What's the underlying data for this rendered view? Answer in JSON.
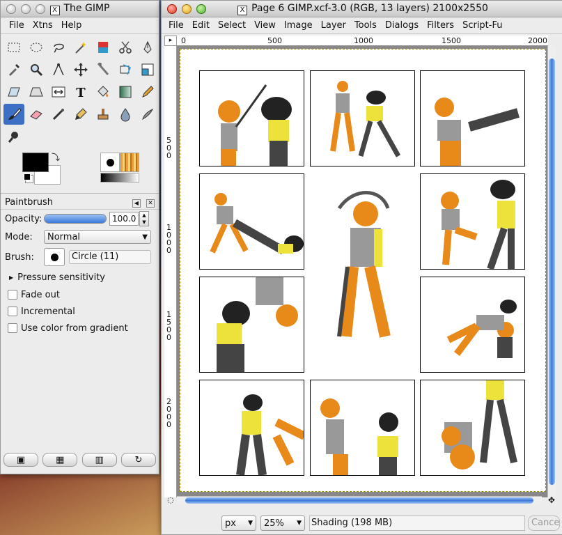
{
  "toolbox": {
    "title": "The GIMP",
    "menu": [
      "File",
      "Xtns",
      "Help"
    ],
    "tools": [
      "rect-select-icon",
      "ellipse-select-icon",
      "lasso-icon",
      "fuzzy-select-icon",
      "color-select-icon",
      "scissors-icon",
      "paths-icon",
      "color-picker-icon",
      "magnify-icon",
      "measure-icon",
      "move-icon",
      "crop-icon",
      "rotate-icon",
      "scale-icon",
      "shear-icon",
      "perspective-icon",
      "flip-icon",
      "text-icon",
      "bucket-fill-icon",
      "blend-icon",
      "pencil-icon",
      "paintbrush-icon",
      "eraser-icon",
      "airbrush-icon",
      "ink-icon",
      "clone-icon",
      "convolve-icon",
      "smudge-icon",
      "dodge-burn-icon"
    ],
    "fg_color": "#000000",
    "bg_color": "#ffffff",
    "options": {
      "title": "Paintbrush",
      "opacity_label": "Opacity:",
      "opacity_value": "100.0",
      "opacity_fraction": 1.0,
      "mode_label": "Mode:",
      "mode_value": "Normal",
      "brush_label": "Brush:",
      "brush_value": "Circle (11)",
      "pressure_label": "Pressure sensitivity",
      "checkboxes": [
        "Fade out",
        "Incremental",
        "Use color from gradient"
      ]
    }
  },
  "image_window": {
    "title": "Page 6 GIMP.xcf-3.0 (RGB, 13 layers) 2100x2550",
    "menu": [
      "File",
      "Edit",
      "Select",
      "View",
      "Image",
      "Layer",
      "Tools",
      "Dialogs",
      "Filters",
      "Script-Fu"
    ],
    "ruler_h": [
      "0",
      "500",
      "1000",
      "1500",
      "2000"
    ],
    "ruler_v": [
      "500",
      "1000",
      "1500",
      "2000"
    ],
    "unit": "px",
    "zoom": "25%",
    "status": "Shading (198 MB)",
    "cancel": "Cancel"
  }
}
